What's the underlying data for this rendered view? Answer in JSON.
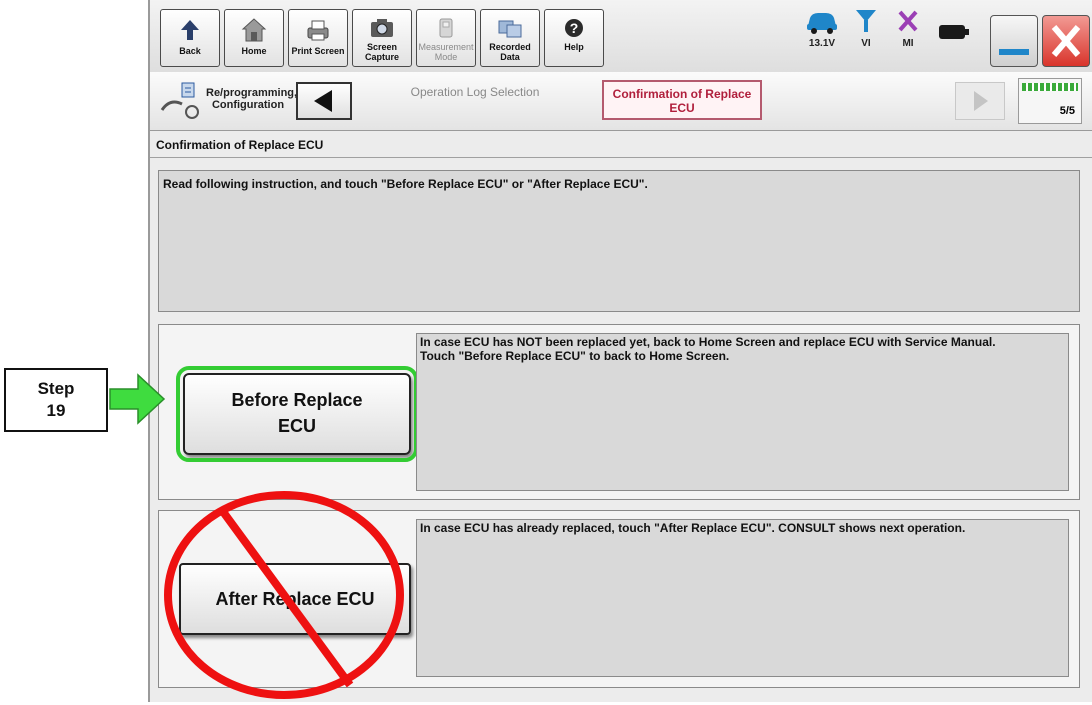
{
  "toolbar": {
    "back": "Back",
    "home": "Home",
    "print_screen": "Print Screen",
    "screen_capture": "Screen Capture",
    "measurement_mode": "Measurement Mode",
    "recorded_data": "Recorded Data",
    "help": "Help",
    "status": {
      "voltage": "13.1V",
      "vi": "VI",
      "mi": "MI"
    }
  },
  "breadcrumb": {
    "section": "Re/programming, Configuration",
    "previous_step": "Operation Log Selection",
    "current_step": "Confirmation of Replace ECU",
    "progress": "5/5",
    "progress_fraction": 1.0
  },
  "page": {
    "title": "Confirmation of Replace ECU",
    "instruction": "Read following instruction, and touch \"Before Replace ECU\" or \"After Replace ECU\"."
  },
  "before": {
    "button_line1": "Before Replace",
    "button_line2": "ECU",
    "desc_line1": "In case ECU has NOT been replaced yet, back to Home Screen and replace ECU with Service  Manual.",
    "desc_line2": "Touch \"Before Replace ECU\" to back to Home Screen."
  },
  "after": {
    "button": "After Replace ECU",
    "desc": "In case ECU has already replaced, touch \"After Replace ECU\". CONSULT shows next operation."
  },
  "annotation": {
    "step_label": "Step",
    "step_number": "19",
    "highlight_color": "#33cc33",
    "prohibit_color": "#ee1111"
  }
}
